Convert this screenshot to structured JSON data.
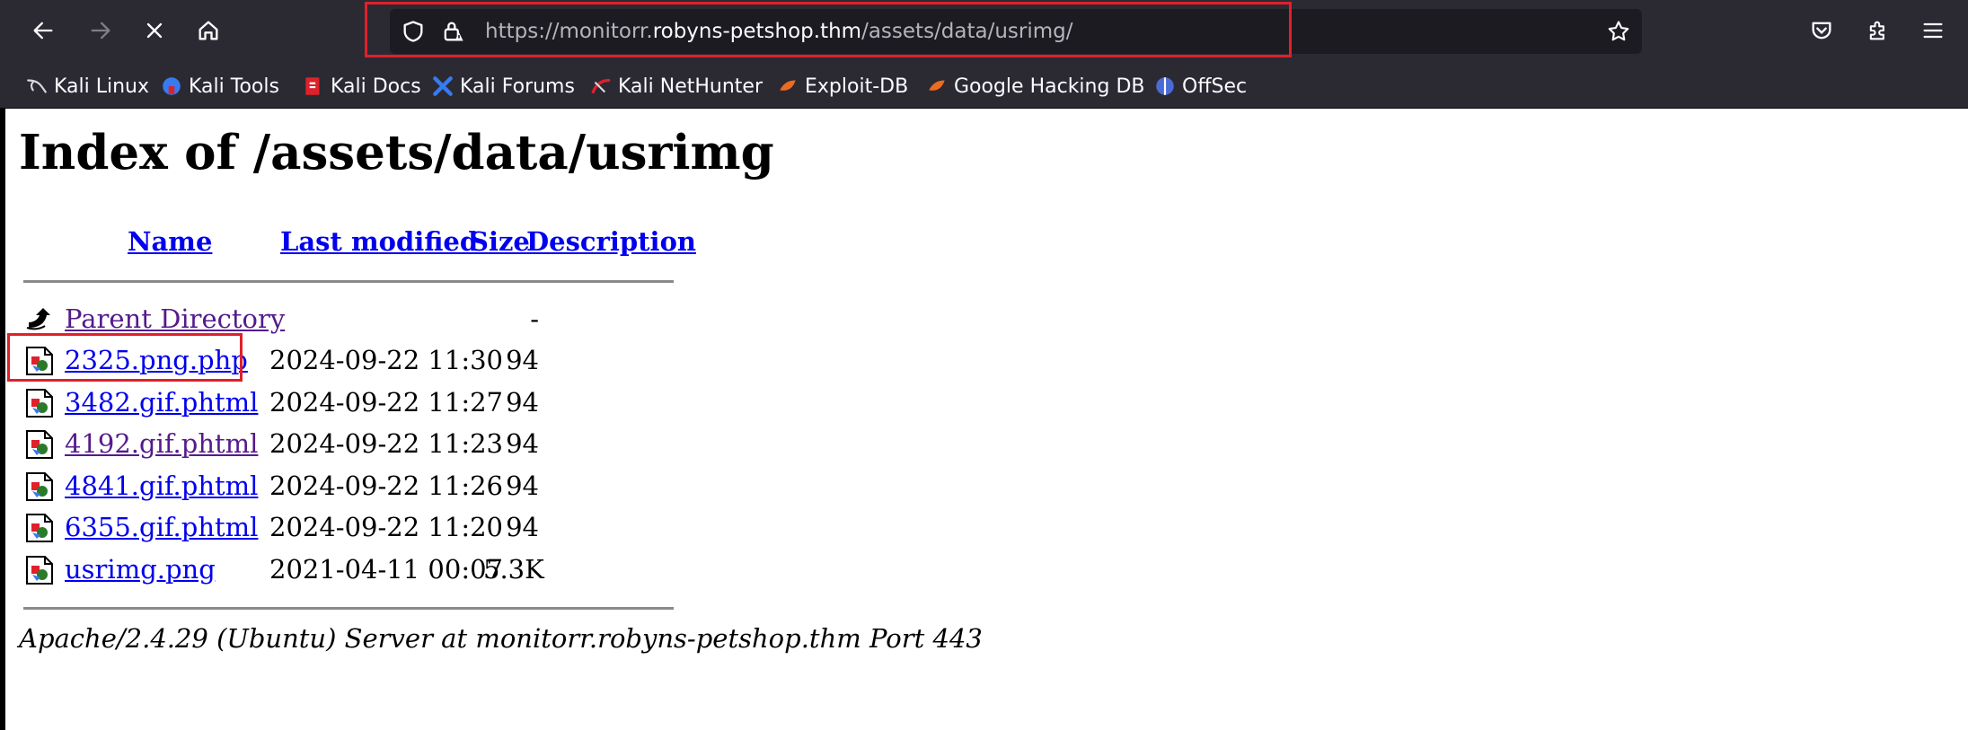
{
  "browser": {
    "url": {
      "prefix": "https://monitorr.",
      "domain": "robyns-petshop.thm",
      "path": "/assets/data/usrimg/"
    },
    "bookmarks": [
      {
        "label": "Kali Linux",
        "icon": "kali-dragon-icon"
      },
      {
        "label": "Kali Tools",
        "icon": "kali-tools-icon"
      },
      {
        "label": "Kali Docs",
        "icon": "kali-docs-icon"
      },
      {
        "label": "Kali Forums",
        "icon": "kali-forums-icon"
      },
      {
        "label": "Kali NetHunter",
        "icon": "nethunter-icon"
      },
      {
        "label": "Exploit-DB",
        "icon": "exploit-db-icon"
      },
      {
        "label": "Google Hacking DB",
        "icon": "ghdb-icon"
      },
      {
        "label": "OffSec",
        "icon": "offsec-icon"
      }
    ]
  },
  "page": {
    "title": "Index of /assets/data/usrimg",
    "columns": {
      "name": "Name",
      "modified": "Last modified",
      "size": "Size",
      "description": "Description"
    },
    "parent": {
      "name": "Parent Directory",
      "size": "-"
    },
    "files": [
      {
        "name": "2325.png.php",
        "modified": "2024-09-22 11:30",
        "size": "94"
      },
      {
        "name": "3482.gif.phtml",
        "modified": "2024-09-22 11:27",
        "size": "94"
      },
      {
        "name": "4192.gif.phtml",
        "modified": "2024-09-22 11:23",
        "size": "94"
      },
      {
        "name": "4841.gif.phtml",
        "modified": "2024-09-22 11:26",
        "size": "94"
      },
      {
        "name": "6355.gif.phtml",
        "modified": "2024-09-22 11:20",
        "size": "94"
      },
      {
        "name": "usrimg.png",
        "modified": "2021-04-11 00:07",
        "size": "5.3K"
      }
    ],
    "address": "Apache/2.4.29 (Ubuntu) Server at monitorr.robyns-petshop.thm Port 443"
  },
  "colors": {
    "link": "#0000ee",
    "visited": "#551a8b",
    "highlight": "#e0202a",
    "chrome": "#2b2a33"
  }
}
